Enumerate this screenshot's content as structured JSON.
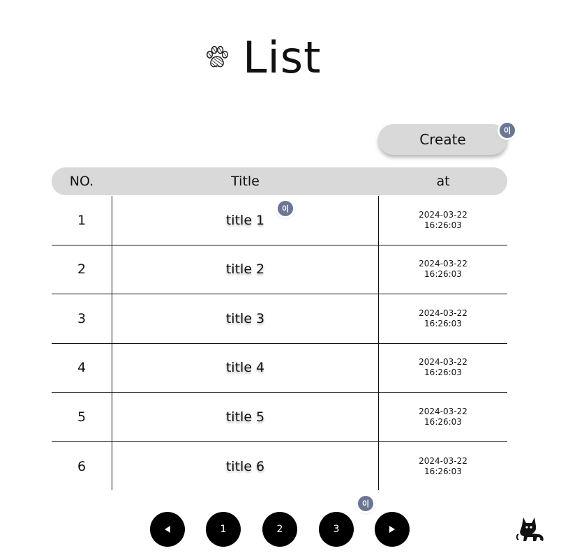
{
  "page": {
    "title": "List"
  },
  "toolbar": {
    "create_label": "Create"
  },
  "presence": {
    "avatar_initial": "이"
  },
  "table": {
    "columns": [
      "NO.",
      "Title",
      "at"
    ],
    "rows": [
      {
        "no": "1",
        "title": "title 1",
        "date": "2024-03-22",
        "time": "16:26:03"
      },
      {
        "no": "2",
        "title": "title 2",
        "date": "2024-03-22",
        "time": "16:26:03"
      },
      {
        "no": "3",
        "title": "title 3",
        "date": "2024-03-22",
        "time": "16:26:03"
      },
      {
        "no": "4",
        "title": "title 4",
        "date": "2024-03-22",
        "time": "16:26:03"
      },
      {
        "no": "5",
        "title": "title 5",
        "date": "2024-03-22",
        "time": "16:26:03"
      },
      {
        "no": "6",
        "title": "title 6",
        "date": "2024-03-22",
        "time": "16:26:03"
      }
    ]
  },
  "pagination": {
    "prev_icon": "triangle-left-icon",
    "next_icon": "triangle-right-icon",
    "pages": [
      "1",
      "2",
      "3"
    ]
  },
  "icons": {
    "title_icon": "paw-icon",
    "corner_icon": "black-cat-icon"
  },
  "colors": {
    "header_bg": "#d9d9d9",
    "avatar_bg": "#6b7694",
    "pager_bg": "#000000"
  }
}
